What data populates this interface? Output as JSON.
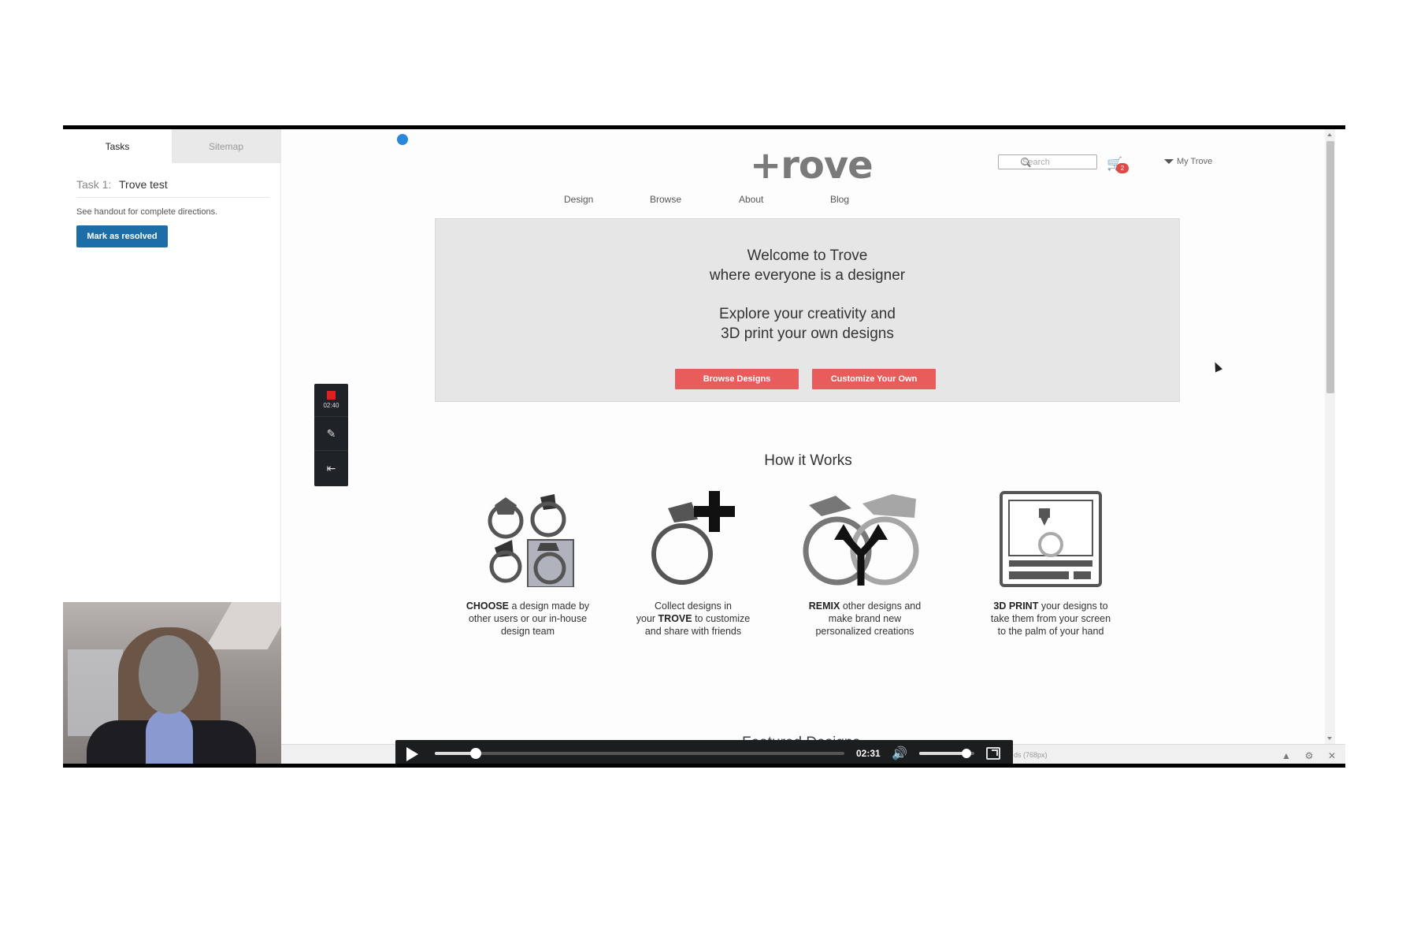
{
  "panel": {
    "tabs": [
      {
        "label": "Tasks",
        "active": true
      },
      {
        "label": "Sitemap",
        "active": false
      }
    ],
    "task_number": "Task 1:",
    "task_name": "Trove test",
    "hint": "See handout for complete directions.",
    "resolve_label": "Mark as resolved"
  },
  "site": {
    "logo": "+rove",
    "search_placeholder": "Search",
    "cart_count": "2",
    "account_label": "My Trove",
    "nav": [
      "Design",
      "Browse",
      "About",
      "Blog"
    ],
    "hero": {
      "line1": "Welcome to Trove",
      "line2": "where everyone is a designer",
      "line3": "Explore your creativity and",
      "line4": "3D print your own designs",
      "browse_label": "Browse Designs",
      "customize_label": "Customize Your Own"
    },
    "how_title": "How it Works",
    "steps": [
      {
        "bold": "CHOOSE",
        "text1": " a design made by",
        "text2": "other users or our in-house",
        "text3": "design team"
      },
      {
        "pre": "Collect designs in",
        "line2_pre": "your ",
        "bold": "TROVE",
        "line2_post": " to customize",
        "line3": "and share with friends"
      },
      {
        "bold": "REMIX",
        "text1": " other designs and",
        "text2": "make brand new",
        "text3": "personalized creations"
      },
      {
        "bold": "3D PRINT",
        "text1": " your designs to",
        "text2": "take them from your screen",
        "text3": "to the palm of your hand"
      }
    ],
    "featured_peek": "Featured Designs"
  },
  "recorder": {
    "elapsed": "02:40"
  },
  "player": {
    "time": "02:31",
    "progress": 0.1,
    "volume": 0.85
  },
  "toolbar": {
    "viewport_label": "ds (768px)"
  },
  "colors": {
    "accent_red": "#e85c5c",
    "resolve_blue": "#1d6ea7",
    "cursor_dot": "#2a88d8"
  }
}
